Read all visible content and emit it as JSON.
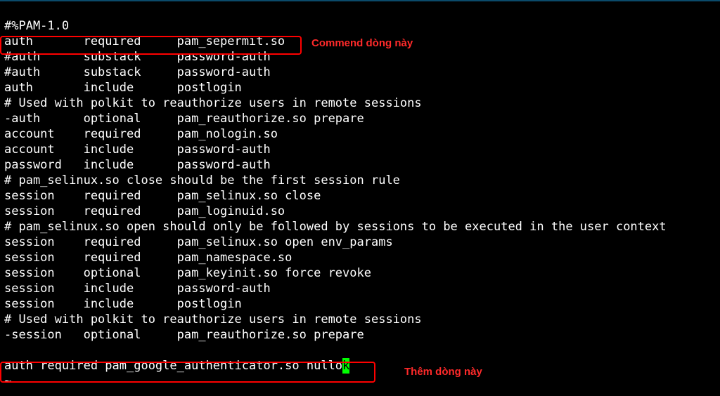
{
  "annotations": {
    "callout1": "Commend dòng này",
    "callout2": "Thêm dòng này"
  },
  "lines": {
    "l0": "#%PAM-1.0",
    "l1": "auth       required     pam_sepermit.so",
    "l2": "#auth      substack     password-auth",
    "l3": "#auth      substack     password-auth",
    "l4": "auth       include      postlogin",
    "l5": "# Used with polkit to reauthorize users in remote sessions",
    "l6": "-auth      optional     pam_reauthorize.so prepare",
    "l7": "account    required     pam_nologin.so",
    "l8": "account    include      password-auth",
    "l9": "password   include      password-auth",
    "l10": "# pam_selinux.so close should be the first session rule",
    "l11": "session    required     pam_selinux.so close",
    "l12": "session    required     pam_loginuid.so",
    "l13": "# pam_selinux.so open should only be followed by sessions to be executed in the user context",
    "l14": "session    required     pam_selinux.so open env_params",
    "l15": "session    required     pam_namespace.so",
    "l16": "session    optional     pam_keyinit.so force revoke",
    "l17": "session    include      password-auth",
    "l18": "session    include      postlogin",
    "l19": "# Used with polkit to reauthorize users in remote sessions",
    "l20": "-session   optional     pam_reauthorize.so prepare",
    "l21": "",
    "l22_pre": "auth required pam_google_authenticator.so nullo",
    "l22_cursor": "k",
    "l23": "~"
  }
}
